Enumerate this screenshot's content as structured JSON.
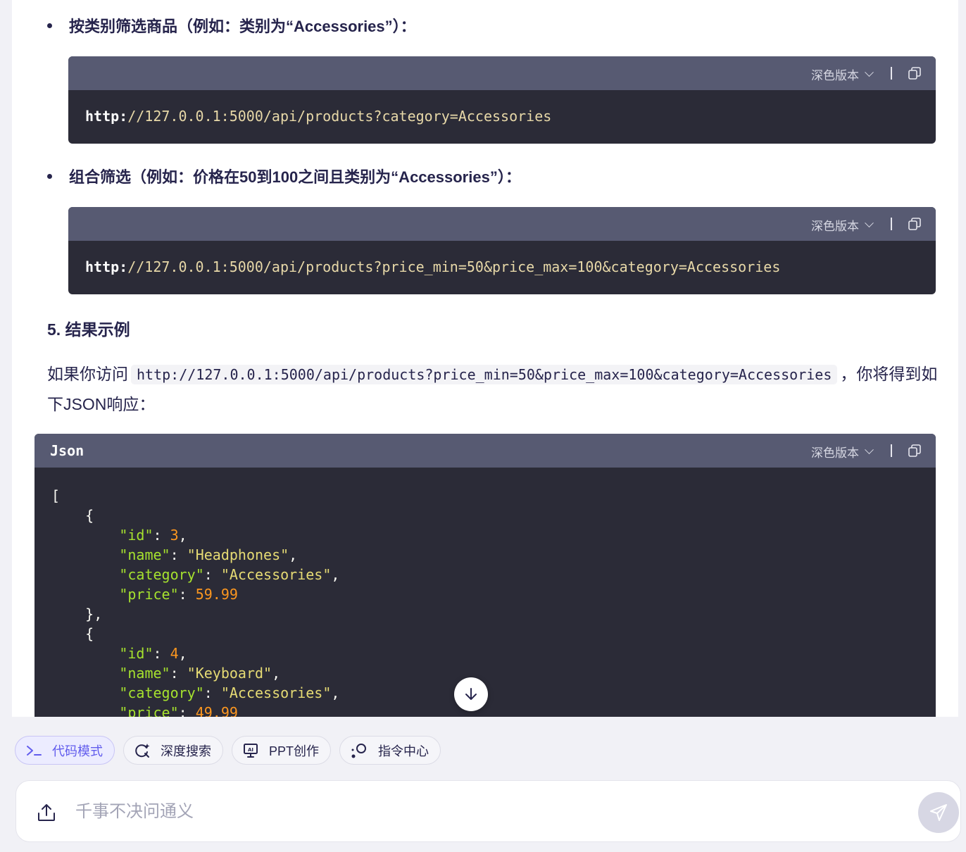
{
  "bullets": [
    {
      "text": "按类别筛选商品（例如：类别为“Accessories”）："
    },
    {
      "text": "组合筛选（例如：价格在50到100之间且类别为“Accessories”）："
    }
  ],
  "code_blocks": [
    {
      "theme": "深色版本",
      "prefix": "http:",
      "path": "//127.0.0.1:5000/api/products?category=Accessories"
    },
    {
      "theme": "深色版本",
      "prefix": "http:",
      "path": "//127.0.0.1:5000/api/products?price_min=50&price_max=100&category=Accessories"
    }
  ],
  "section": {
    "title": "5. 结果示例"
  },
  "paragraph": {
    "before": "如果你访问",
    "code": "http://127.0.0.1:5000/api/products?price_min=50&price_max=100&category=Accessories",
    "after": "，你将得到如下JSON响应："
  },
  "json_block": {
    "lang": "Json",
    "theme": "深色版本",
    "items": [
      {
        "id": "3",
        "name": "\"Headphones\"",
        "category": "\"Accessories\"",
        "price": "59.99"
      },
      {
        "id": "4",
        "name": "\"Keyboard\"",
        "category": "\"Accessories\"",
        "price": "49.99"
      }
    ],
    "keys": {
      "id": "\"id\"",
      "name": "\"name\"",
      "category": "\"category\"",
      "price": "\"price\""
    }
  },
  "tools": [
    {
      "label": "代码模式",
      "icon": "terminal-icon",
      "active": true
    },
    {
      "label": "深度搜索",
      "icon": "deep-search-icon",
      "active": false
    },
    {
      "label": "PPT创作",
      "icon": "presentation-icon",
      "active": false
    },
    {
      "label": "指令中心",
      "icon": "command-center-icon",
      "active": false
    }
  ],
  "input": {
    "placeholder": "千事不决问通义"
  },
  "colors": {
    "accent": "#615ced",
    "code_bg": "#2b2b37",
    "code_header": "#575a72",
    "text": "#26244c"
  }
}
